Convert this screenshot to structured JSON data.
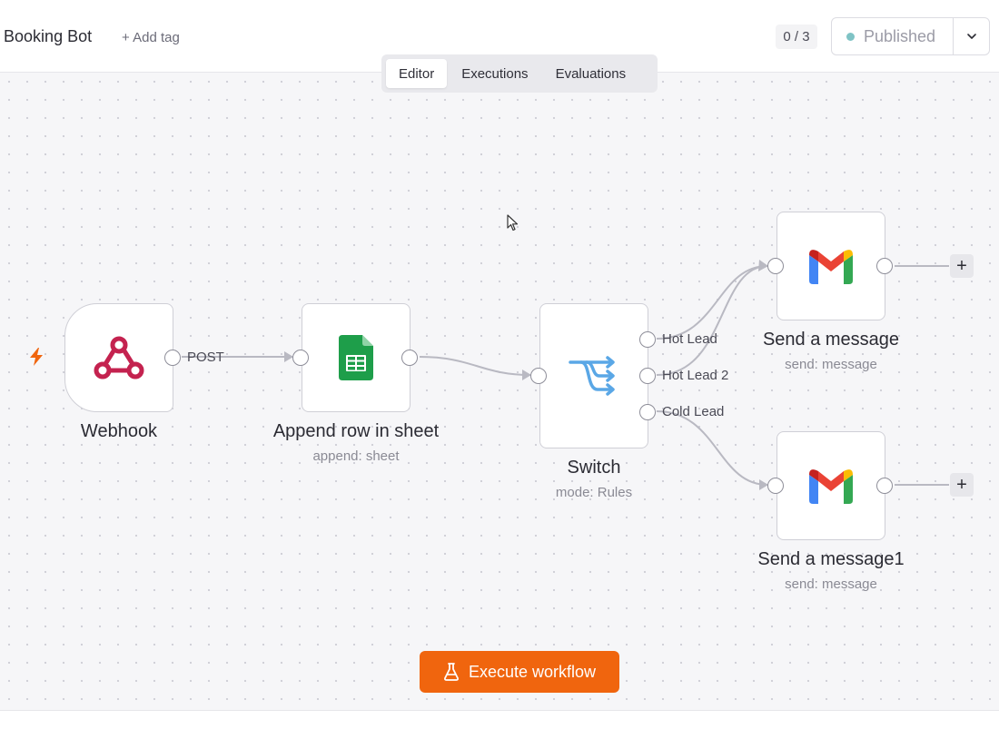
{
  "header": {
    "workflow_name": "Booking Bot",
    "workflow_name_prefix": "t",
    "add_tag_label": "+ Add tag",
    "counter": "0 / 3",
    "publish_label": "Published",
    "publish_status_color": "#7fc3c5"
  },
  "tabs": [
    {
      "label": "Editor",
      "active": true
    },
    {
      "label": "Executions",
      "active": false
    },
    {
      "label": "Evaluations",
      "active": false
    }
  ],
  "nodes": {
    "webhook": {
      "title": "Webhook",
      "icon": "webhook-icon"
    },
    "append_row": {
      "title": "Append row in sheet",
      "subtitle": "append: sheet",
      "icon": "google-sheets-icon"
    },
    "switch": {
      "title": "Switch",
      "subtitle": "mode: Rules",
      "icon": "switch-icon"
    },
    "send_message": {
      "title": "Send a message",
      "subtitle": "send: message",
      "icon": "gmail-icon"
    },
    "send_message1": {
      "title": "Send a message1",
      "subtitle": "send: message",
      "icon": "gmail-icon"
    }
  },
  "edge_labels": {
    "webhook_out": "POST",
    "switch_out_1": "Hot Lead",
    "switch_out_2": "Hot Lead 2",
    "switch_out_3": "Cold Lead"
  },
  "add_node_label": "+",
  "execute_button": {
    "label": "Execute workflow",
    "color": "#f0650e"
  },
  "colors": {
    "accent_orange": "#f0650e",
    "webhook_red": "#c4224f",
    "sheets_green": "#1e9e4a",
    "switch_blue": "#5aa7e6"
  }
}
